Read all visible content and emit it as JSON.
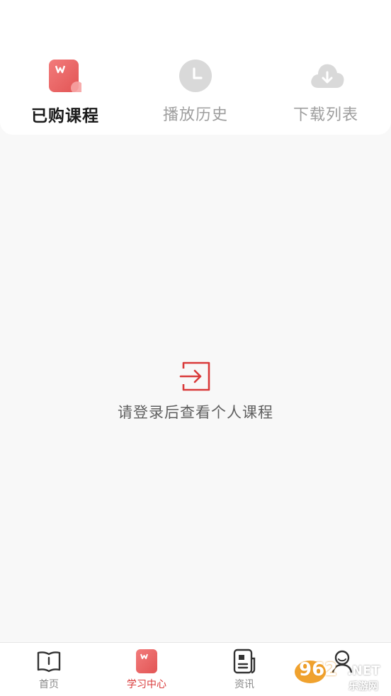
{
  "tabs": [
    {
      "label": "已购课程",
      "icon": "purchased-courses-icon",
      "active": true
    },
    {
      "label": "播放历史",
      "icon": "clock-icon",
      "active": false
    },
    {
      "label": "下载列表",
      "icon": "cloud-download-icon",
      "active": false
    }
  ],
  "empty_state": {
    "icon": "login-icon",
    "message": "请登录后查看个人课程"
  },
  "bottom_nav": [
    {
      "label": "首页",
      "icon": "book-open-icon",
      "active": false
    },
    {
      "label": "学习中心",
      "icon": "study-center-icon",
      "active": true
    },
    {
      "label": "资讯",
      "icon": "news-icon",
      "active": false
    },
    {
      "label": "",
      "icon": "profile-icon",
      "active": false
    }
  ],
  "watermark": {
    "brand": "962",
    "suffix": ".NET",
    "sub": "乐游网"
  },
  "colors": {
    "accent": "#d93a3a",
    "accent_gradient_start": "#f27b7b",
    "accent_gradient_end": "#e25555",
    "inactive_icon": "#d9d9d9",
    "inactive_text": "#9e9e9e",
    "background": "#f8f8f8",
    "watermark_orange": "#f0a22e"
  }
}
